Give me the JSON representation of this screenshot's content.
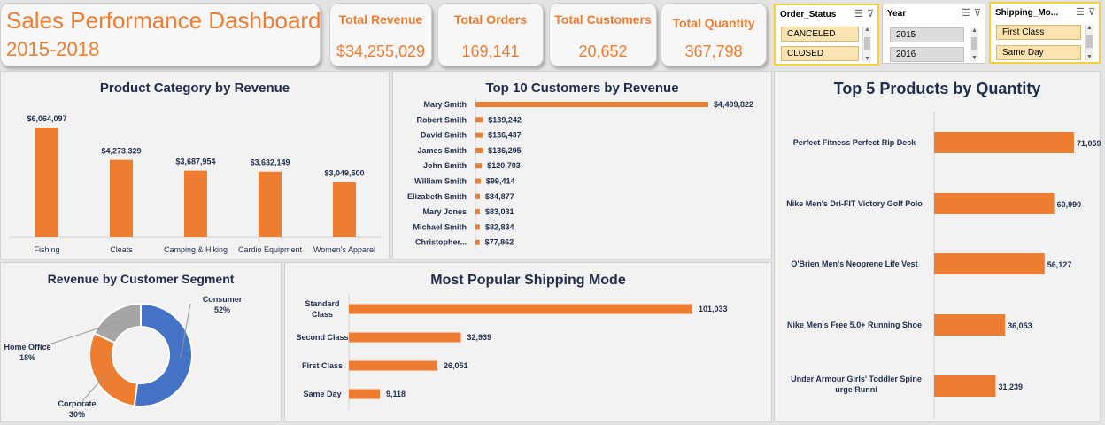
{
  "header": {
    "title": "Sales Performance Dashboard",
    "subtitle": "2015-2018"
  },
  "kpis": [
    {
      "label": "Total Revenue",
      "value": "$34,255,029"
    },
    {
      "label": "Total Orders",
      "value": "169,141"
    },
    {
      "label": "Total Customers",
      "value": "20,652"
    },
    {
      "label": "Total Quantity",
      "value": "367,798"
    }
  ],
  "slicers": [
    {
      "title": "Order_Status",
      "items": [
        "CANCELED",
        "CLOSED"
      ],
      "state": "selected"
    },
    {
      "title": "Year",
      "items": [
        "2015",
        "2016"
      ],
      "state": "unselected"
    },
    {
      "title": "Shipping_Mo...",
      "items": [
        "First Class",
        "Same Day"
      ],
      "state": "selected"
    }
  ],
  "icons": {
    "multiselect": "multi-select-icon",
    "clear_filter": "clear-filter-icon",
    "scroll_up": "scroll-up-icon",
    "scroll_down": "scroll-down-icon"
  },
  "colors": {
    "accent": "#ed7d31",
    "navy": "#1f2d4d",
    "blue": "#4472c4",
    "gray": "#a5a5a5",
    "slicer_selected": "#fce4b2",
    "slicer_border": "#f5d03b"
  },
  "chart_data": [
    {
      "id": "category",
      "type": "bar",
      "title": "Product Category by Revenue",
      "categories": [
        "Fishing",
        "Cleats",
        "Camping & Hiking",
        "Cardio Equipment",
        "Women's Apparel"
      ],
      "values": [
        6064097,
        4273329,
        3687954,
        3632149,
        3049500
      ],
      "labels": [
        "$6,064,097",
        "$4,273,329",
        "$3,687,954",
        "$3,632,149",
        "$3,049,500"
      ],
      "ylim": [
        0,
        6700000
      ]
    },
    {
      "id": "customers",
      "type": "bar",
      "orientation": "horizontal",
      "title": "Top 10 Customers by Revenue",
      "categories": [
        "Mary Smith",
        "Robert Smith",
        "David Smith",
        "James Smith",
        "John Smith",
        "William Smith",
        "Elizabeth Smith",
        "Mary Jones",
        "Michael Smith",
        "Christopher..."
      ],
      "values": [
        4409822,
        139242,
        136437,
        136295,
        120703,
        99414,
        84877,
        83031,
        82834,
        77862
      ],
      "labels": [
        "$4,409,822",
        "$139,242",
        "$136,437",
        "$136,295",
        "$120,703",
        "$99,414",
        "$84,877",
        "$83,031",
        "$82,834",
        "$77,862"
      ],
      "xlim": [
        0,
        4409822
      ]
    },
    {
      "id": "products",
      "type": "bar",
      "orientation": "horizontal",
      "title": "Top 5 Products by Quantity",
      "categories": [
        "Perfect Fitness Perfect Rip Deck",
        "Nike Men's Dri-FIT Victory Golf Polo",
        "O'Brien Men's Neoprene Life Vest",
        "Nike Men's Free 5.0+ Running Shoe",
        "Under Armour Girls' Toddler Spine Surge Runni"
      ],
      "values": [
        71059,
        60990,
        56127,
        36053,
        31239
      ],
      "labels": [
        "71,059",
        "60,990",
        "56,127",
        "36,053",
        "31,239"
      ],
      "xlim": [
        0,
        71059
      ]
    },
    {
      "id": "segment",
      "type": "pie",
      "title": "Revenue by Customer Segment",
      "categories": [
        "Consumer",
        "Corporate",
        "Home Office"
      ],
      "values": [
        52,
        30,
        18
      ],
      "labels": [
        "52%",
        "30%",
        "18%"
      ],
      "colors": [
        "#4472c4",
        "#ed7d31",
        "#a5a5a5"
      ]
    },
    {
      "id": "shipping",
      "type": "bar",
      "orientation": "horizontal",
      "title": "Most Popular Shipping Mode",
      "categories": [
        "Standard Class",
        "Second Class",
        "First Class",
        "Same Day"
      ],
      "values": [
        101033,
        32939,
        26051,
        9118
      ],
      "labels": [
        "101,033",
        "32,939",
        "26,051",
        "9,118"
      ],
      "xlim": [
        0,
        101033
      ]
    }
  ]
}
